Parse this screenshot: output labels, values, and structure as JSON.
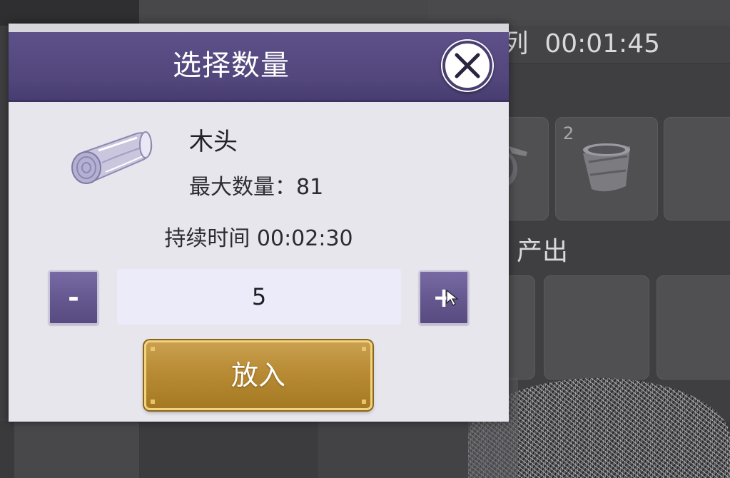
{
  "dialog": {
    "title": "选择数量",
    "close_icon": "close-x-icon",
    "item": {
      "icon": "wood-log-icon",
      "name": "木头",
      "max_label": "最大数量：",
      "max_value": "81"
    },
    "duration_label": "持续时间",
    "duration_value": "00:02:30",
    "decrement_label": "-",
    "increment_label": "+",
    "quantity_value": "5",
    "confirm_label": "放入"
  },
  "background": {
    "queue_label_fragment": "列",
    "queue_timer": "00:01:45",
    "slot_count": "2",
    "slot_item_icon": "bucket-icon",
    "output_label_fragment": "产出"
  },
  "colors": {
    "header_purple": "#52467c",
    "button_purple": "#64578f",
    "confirm_gold": "#b88b34",
    "dialog_bg": "#e9e9ee"
  }
}
